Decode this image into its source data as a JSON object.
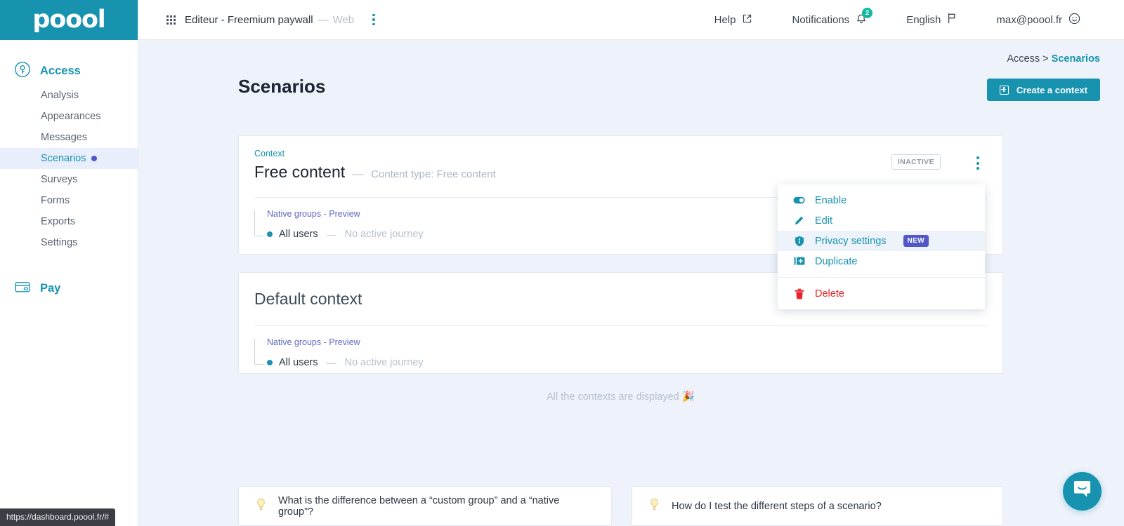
{
  "brand": {
    "logo_text": "poool",
    "accent": "#1793b0",
    "badge_purple": "#5157c9",
    "danger": "#e8232b",
    "notif_green": "#15b9a2"
  },
  "topbar": {
    "project_name": "Editeur - Freemium paywall",
    "project_dash": "—",
    "project_platform": "Web",
    "help_label": "Help",
    "notifications_label": "Notifications",
    "notifications_count": "2",
    "language_label": "English",
    "account_label": "max@poool.fr"
  },
  "sidebar": {
    "groups": [
      {
        "label": "Access",
        "icon": "access-key-icon",
        "items": [
          {
            "label": "Analysis",
            "active": false
          },
          {
            "label": "Appearances",
            "active": false
          },
          {
            "label": "Messages",
            "active": false
          },
          {
            "label": "Scenarios",
            "active": true,
            "dot": true
          },
          {
            "label": "Surveys",
            "active": false
          },
          {
            "label": "Forms",
            "active": false
          },
          {
            "label": "Exports",
            "active": false
          },
          {
            "label": "Settings",
            "active": false
          }
        ]
      },
      {
        "label": "Pay",
        "icon": "credit-card-icon",
        "items": []
      }
    ]
  },
  "main": {
    "breadcrumb_parent": "Access",
    "breadcrumb_sep": ">",
    "breadcrumb_current": "Scenarios",
    "page_title": "Scenarios",
    "create_button": "Create a context",
    "all_displayed": "All the contexts are displayed 🎉"
  },
  "contexts": [
    {
      "kicker": "Context",
      "title": "Free content",
      "dash": "—",
      "subtitle": "Content type: Free content",
      "status_badge": "INACTIVE",
      "group_label": "Native groups - Preview",
      "group_name": "All users",
      "group_dash": "—",
      "group_journey": "No active journey"
    },
    {
      "kicker": "",
      "title": "Default context",
      "dash": "",
      "subtitle": "",
      "status_badge": "",
      "group_label": "Native groups - Preview",
      "group_name": "All users",
      "group_dash": "—",
      "group_journey": "No active journey"
    }
  ],
  "context_menu": {
    "items": [
      {
        "label": "Enable",
        "icon": "toggle-icon",
        "badge": "",
        "danger": false,
        "highlight": false
      },
      {
        "label": "Edit",
        "icon": "pencil-icon",
        "badge": "",
        "danger": false,
        "highlight": false
      },
      {
        "label": "Privacy settings",
        "icon": "shield-icon",
        "badge": "NEW",
        "danger": false,
        "highlight": true
      },
      {
        "label": "Duplicate",
        "icon": "duplicate-icon",
        "badge": "",
        "danger": false,
        "highlight": false
      }
    ],
    "delete": {
      "label": "Delete",
      "icon": "trash-icon",
      "danger": true
    }
  },
  "faq": [
    {
      "text": "What is the difference between a “custom group” and a “native group”?",
      "icon": "lightbulb-icon"
    },
    {
      "text": "How do I test the different steps of a scenario?",
      "icon": "lightbulb-icon"
    }
  ],
  "status_bar": {
    "url": "https://dashboard.poool.fr/#"
  }
}
